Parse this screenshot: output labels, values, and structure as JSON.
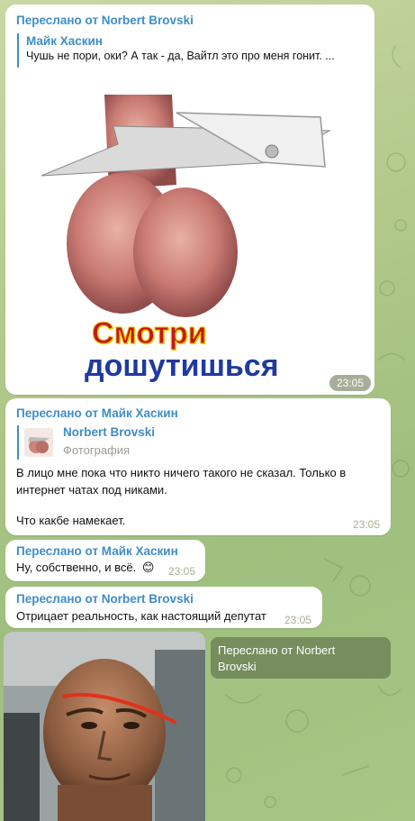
{
  "messages": {
    "m1": {
      "forwarded": "Переслано от Norbert Brovski",
      "quote_name": "Майк Хаскин",
      "quote_text": "Чушь не пори, оки?   А так - да, Вайтл это про меня гонит. ...",
      "image_caption_line1": "Смотри",
      "image_caption_line2": "дошутишься",
      "time": "23:05"
    },
    "m2": {
      "forwarded": "Переслано от Майк Хаскин",
      "quote_name": "Norbert Brovski",
      "quote_subtitle": "Фотография",
      "line1": "В лицо мне пока что никто ничего такого не сказал. Только в",
      "line2": "интернет чатах под никами.",
      "line3": "Что какбе намекает.",
      "time": "23:05"
    },
    "m3": {
      "forwarded": "Переслано от Майк Хаскин",
      "text": "Ну, собственно, и всё.",
      "emoji": "😊",
      "time": "23:05"
    },
    "m4": {
      "forwarded": "Переслано от Norbert Brovski",
      "text": "Отрицает реальность, как настоящий депутат",
      "time": "23:05"
    },
    "m5": {
      "forwarded_line1": "Переслано от Norbert",
      "forwarded_line2": "Brovski"
    }
  },
  "colors": {
    "link_blue": "#3f8dc6",
    "chat_bg": "#b3c98b",
    "bubble": "#ffffff",
    "scribble_red": "#e0321c"
  }
}
